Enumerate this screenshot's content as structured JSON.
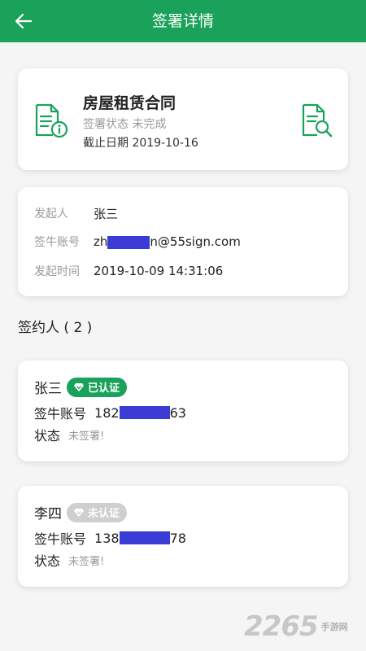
{
  "header": {
    "title": "签署详情"
  },
  "document": {
    "title": "房屋租赁合同",
    "status": "签署状态 未完成",
    "deadline": "截止日期 2019-10-16"
  },
  "info": {
    "initiator_label": "发起人",
    "initiator_value": "张三",
    "account_label": "签牛账号",
    "account_prefix": "zh",
    "account_suffix": "n@55sign.com",
    "time_label": "发起时间",
    "time_value": "2019-10-09 14:31:06"
  },
  "signers_heading": "签约人 ( 2 )",
  "signers": [
    {
      "name": "张三",
      "badge": "已认证",
      "account_label": "签牛账号",
      "account_prefix": "182",
      "account_suffix": "63",
      "status_label": "状态",
      "status_value": "未签署!"
    },
    {
      "name": "李四",
      "badge": "未认证",
      "account_label": "签牛账号",
      "account_prefix": "138",
      "account_suffix": "78",
      "status_label": "状态",
      "status_value": "未签署!"
    }
  ],
  "watermark": {
    "number": "2265",
    "site": "手游网"
  },
  "colors": {
    "brand": "#1aa25a",
    "mask": "#3b3bd6",
    "unverified": "#cfcfcf"
  },
  "icons": [
    "arrow-left-icon",
    "document-info-icon",
    "document-search-icon",
    "diamond-icon"
  ]
}
